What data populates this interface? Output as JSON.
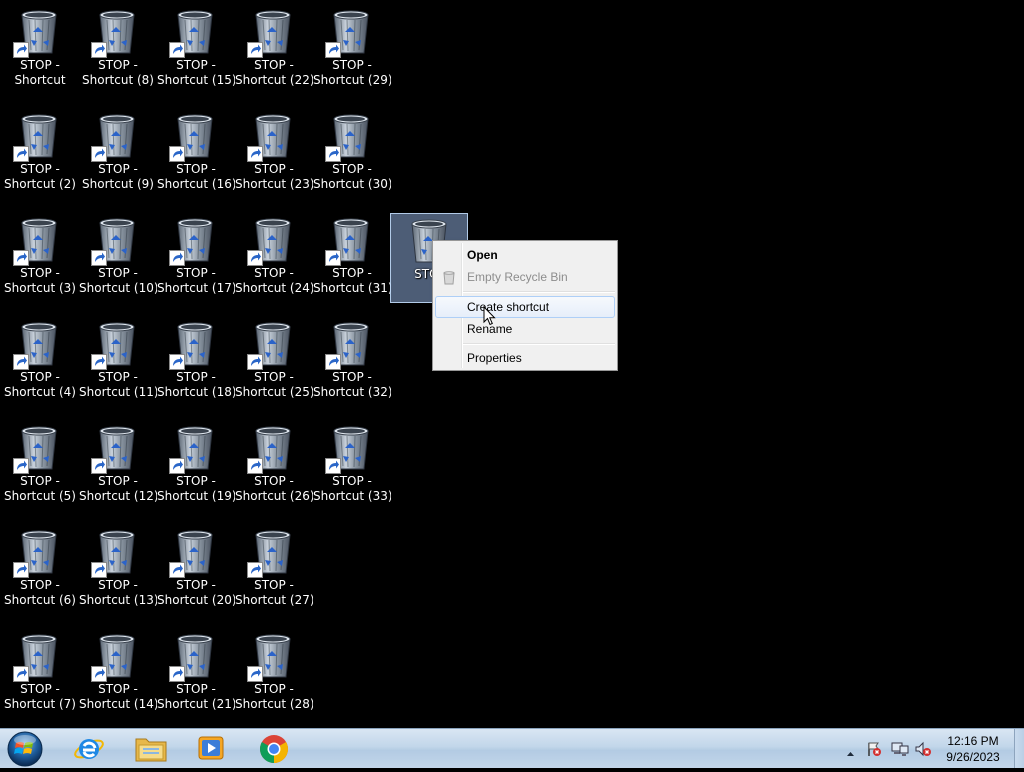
{
  "desktop": {
    "icons": [
      {
        "line1": "STOP -",
        "line2": "Shortcut"
      },
      {
        "line1": "STOP -",
        "line2": "Shortcut (2)"
      },
      {
        "line1": "STOP -",
        "line2": "Shortcut (3)"
      },
      {
        "line1": "STOP -",
        "line2": "Shortcut (4)"
      },
      {
        "line1": "STOP -",
        "line2": "Shortcut (5)"
      },
      {
        "line1": "STOP -",
        "line2": "Shortcut (6)"
      },
      {
        "line1": "STOP -",
        "line2": "Shortcut (7)"
      },
      {
        "line1": "STOP -",
        "line2": "Shortcut (8)"
      },
      {
        "line1": "STOP -",
        "line2": "Shortcut (9)"
      },
      {
        "line1": "STOP -",
        "line2": "Shortcut (10)"
      },
      {
        "line1": "STOP -",
        "line2": "Shortcut (11)"
      },
      {
        "line1": "STOP -",
        "line2": "Shortcut (12)"
      },
      {
        "line1": "STOP -",
        "line2": "Shortcut (13)"
      },
      {
        "line1": "STOP -",
        "line2": "Shortcut (14)"
      },
      {
        "line1": "STOP -",
        "line2": "Shortcut (15)"
      },
      {
        "line1": "STOP -",
        "line2": "Shortcut (16)"
      },
      {
        "line1": "STOP -",
        "line2": "Shortcut (17)"
      },
      {
        "line1": "STOP -",
        "line2": "Shortcut (18)"
      },
      {
        "line1": "STOP -",
        "line2": "Shortcut (19)"
      },
      {
        "line1": "STOP -",
        "line2": "Shortcut (20)"
      },
      {
        "line1": "STOP -",
        "line2": "Shortcut (21)"
      },
      {
        "line1": "STOP -",
        "line2": "Shortcut (22)"
      },
      {
        "line1": "STOP -",
        "line2": "Shortcut (23)"
      },
      {
        "line1": "STOP -",
        "line2": "Shortcut (24)"
      },
      {
        "line1": "STOP -",
        "line2": "Shortcut (25)"
      },
      {
        "line1": "STOP -",
        "line2": "Shortcut (26)"
      },
      {
        "line1": "STOP -",
        "line2": "Shortcut (27)"
      },
      {
        "line1": "STOP -",
        "line2": "Shortcut (28)"
      },
      {
        "line1": "STOP -",
        "line2": "Shortcut (29)"
      },
      {
        "line1": "STOP -",
        "line2": "Shortcut (30)"
      },
      {
        "line1": "STOP -",
        "line2": "Shortcut (31)"
      },
      {
        "line1": "STOP -",
        "line2": "Shortcut (32)"
      },
      {
        "line1": "STOP -",
        "line2": "Shortcut (33)"
      }
    ],
    "selected_icon": {
      "line1": "STOP",
      "icon": "recycle-bin-icon"
    }
  },
  "context_menu": {
    "items": [
      {
        "label": "Open",
        "bold": true
      },
      {
        "label": "Empty Recycle Bin",
        "disabled": true,
        "icon": "recycle-bin-small-icon"
      },
      {
        "label": "Create shortcut",
        "hovered": true
      },
      {
        "label": "Rename"
      },
      {
        "label": "Properties"
      }
    ]
  },
  "taskbar": {
    "start_icon": "windows-start-orb-icon",
    "pinned": [
      {
        "icon": "internet-explorer-icon"
      },
      {
        "icon": "file-explorer-icon"
      },
      {
        "icon": "media-player-icon"
      },
      {
        "icon": "chrome-icon"
      }
    ],
    "tray_icons": [
      "show-hidden-icons-chevron-icon",
      "action-center-flag-icon",
      "network-icon",
      "volume-muted-icon"
    ],
    "clock": {
      "time": "12:16 PM",
      "date": "9/26/2023"
    }
  },
  "colors": {
    "desktop_bg": "#000000",
    "selection": "#8caad7",
    "menu_hover_border": "#aecff7",
    "taskbar": "#c2d6ea"
  }
}
